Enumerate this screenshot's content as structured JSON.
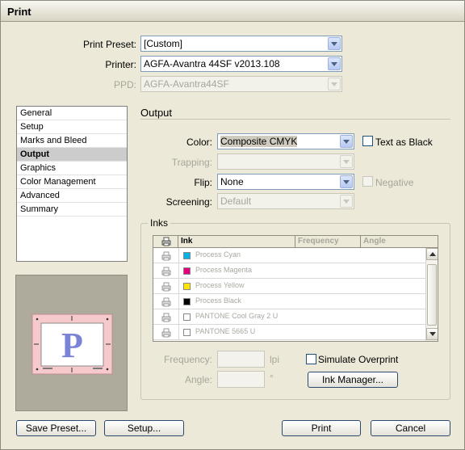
{
  "window": {
    "title": "Print"
  },
  "top": {
    "preset_label": "Print Preset:",
    "preset_value": "[Custom]",
    "printer_label": "Printer:",
    "printer_value": "AGFA-Avantra 44SF v2013.108",
    "ppd_label": "PPD:",
    "ppd_value": "AGFA-Avantra44SF"
  },
  "sidebar": {
    "items": [
      {
        "label": "General"
      },
      {
        "label": "Setup"
      },
      {
        "label": "Marks and Bleed"
      },
      {
        "label": "Output"
      },
      {
        "label": "Graphics"
      },
      {
        "label": "Color Management"
      },
      {
        "label": "Advanced"
      },
      {
        "label": "Summary"
      }
    ],
    "selected": "Output"
  },
  "preview": {
    "glyph": "P"
  },
  "output": {
    "section_title": "Output",
    "color_label": "Color:",
    "color_value": "Composite CMYK",
    "text_as_black_label": "Text as Black",
    "text_as_black_checked": false,
    "trapping_label": "Trapping:",
    "trapping_value": "",
    "flip_label": "Flip:",
    "flip_value": "None",
    "negative_label": "Negative",
    "negative_checked": false,
    "screening_label": "Screening:",
    "screening_value": "Default"
  },
  "inks": {
    "group_title": "Inks",
    "columns": {
      "ink": "Ink",
      "frequency": "Frequency",
      "angle": "Angle"
    },
    "rows": [
      {
        "name": "Process Cyan",
        "color": "#00b4e6"
      },
      {
        "name": "Process Magenta",
        "color": "#e6007e"
      },
      {
        "name": "Process Yellow",
        "color": "#ffe600"
      },
      {
        "name": "Process Black",
        "color": "#000000"
      },
      {
        "name": "PANTONE Cool Gray 2 U",
        "color": "#ffffff"
      },
      {
        "name": "PANTONE 5665 U",
        "color": "#ffffff"
      }
    ],
    "frequency_label": "Frequency:",
    "frequency_unit": "lpi",
    "angle_label": "Angle:",
    "angle_unit": "°",
    "simulate_overprint_label": "Simulate Overprint",
    "simulate_overprint_checked": false,
    "ink_manager_label": "Ink Manager..."
  },
  "buttons": {
    "save_preset": "Save Preset...",
    "setup": "Setup...",
    "print": "Print",
    "cancel": "Cancel"
  },
  "colors": {
    "dialog_bg": "#ece9d8",
    "preview_page": "#f6c9cc",
    "preview_glyph": "#7b83d6"
  }
}
